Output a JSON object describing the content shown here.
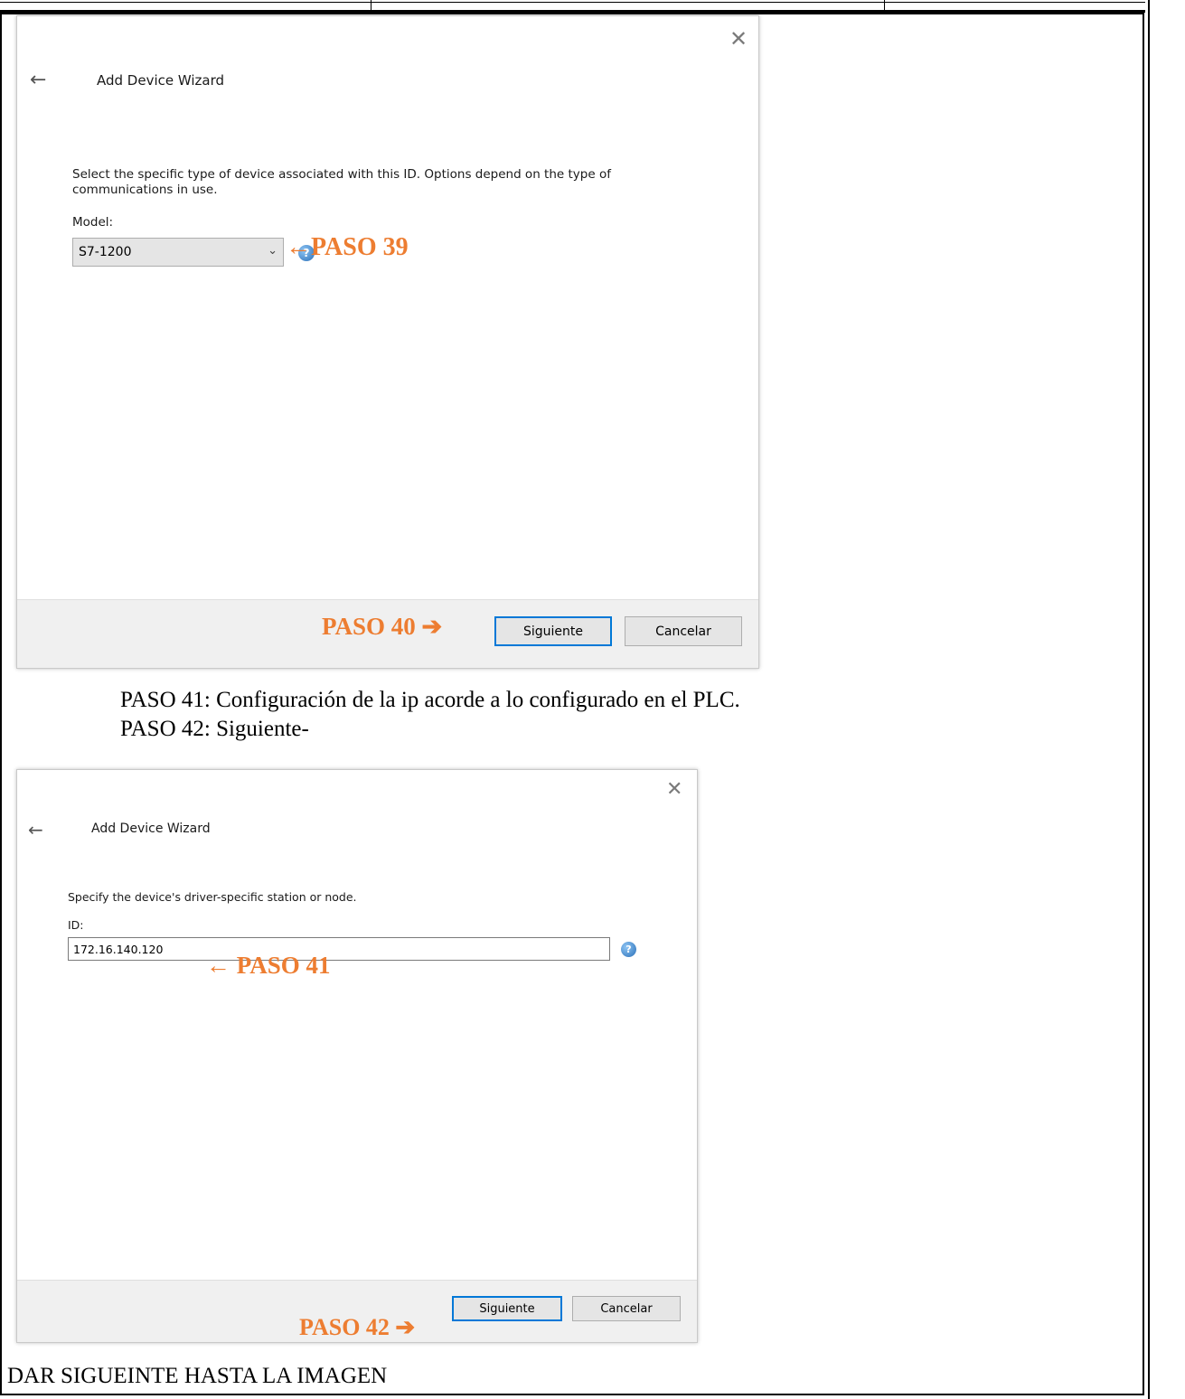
{
  "dialog1": {
    "title": "Add Device Wizard",
    "close_glyph": "✕",
    "back_glyph": "←",
    "description": "Select the specific type of device associated with this ID. Options depend on the type of communications in use.",
    "model_label": "Model:",
    "model_value": "S7-1200",
    "next_label": "Siguiente",
    "cancel_label": "Cancelar"
  },
  "dialog2": {
    "title": "Add Device Wizard",
    "close_glyph": "✕",
    "back_glyph": "←",
    "description": "Specify the device's driver-specific station or node.",
    "id_label": "ID:",
    "id_value": "172.16.140.120",
    "next_label": "Siguiente",
    "cancel_label": "Cancelar"
  },
  "annotations": {
    "paso39": "←PASO 39",
    "paso40": "PASO 40 ➔",
    "paso41": "← PASO 41",
    "paso42": "PASO 42 ➔"
  },
  "document": {
    "line1": "PASO 41: Configuración de la ip acorde a lo configurado en el PLC.",
    "line2": "PASO 42: Siguiente-",
    "footer": "DAR SIGUEINTE HASTA LA IMAGEN"
  },
  "icons": {
    "help": "?",
    "chevron": "⌄"
  },
  "colors": {
    "annotation": "#ed7d31",
    "primary_border": "#0078d7"
  }
}
